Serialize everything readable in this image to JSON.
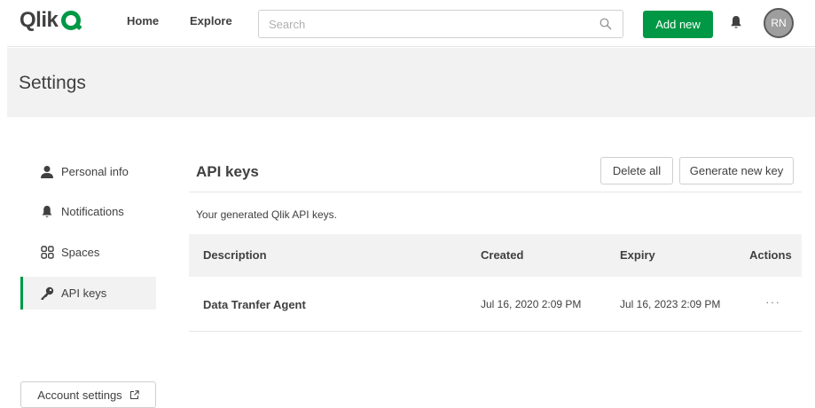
{
  "topbar": {
    "logo_text": "Qlik",
    "nav": {
      "home": "Home",
      "explore": "Explore"
    },
    "search": {
      "placeholder": "Search",
      "value": ""
    },
    "add_new_label": "Add new",
    "avatar_initials": "RN",
    "accent_color": "#009845"
  },
  "header": {
    "title": "Settings"
  },
  "sidebar": {
    "items": [
      {
        "label": "Personal info",
        "icon": "person-icon",
        "active": false
      },
      {
        "label": "Notifications",
        "icon": "bell-icon",
        "active": false
      },
      {
        "label": "Spaces",
        "icon": "spaces-grid-icon",
        "active": false
      },
      {
        "label": "API keys",
        "icon": "key-icon",
        "active": true
      }
    ],
    "account_settings_label": "Account settings"
  },
  "main": {
    "title": "API keys",
    "subtitle": "Your generated Qlik API keys.",
    "delete_all_label": "Delete all",
    "generate_label": "Generate new key",
    "table": {
      "headers": {
        "description": "Description",
        "created": "Created",
        "expiry": "Expiry",
        "actions": "Actions"
      },
      "rows": [
        {
          "description": "Data Tranfer Agent",
          "created": "Jul 16, 2020 2:09 PM",
          "expiry": "Jul 16, 2023 2:09 PM",
          "actions": "···"
        }
      ]
    }
  }
}
